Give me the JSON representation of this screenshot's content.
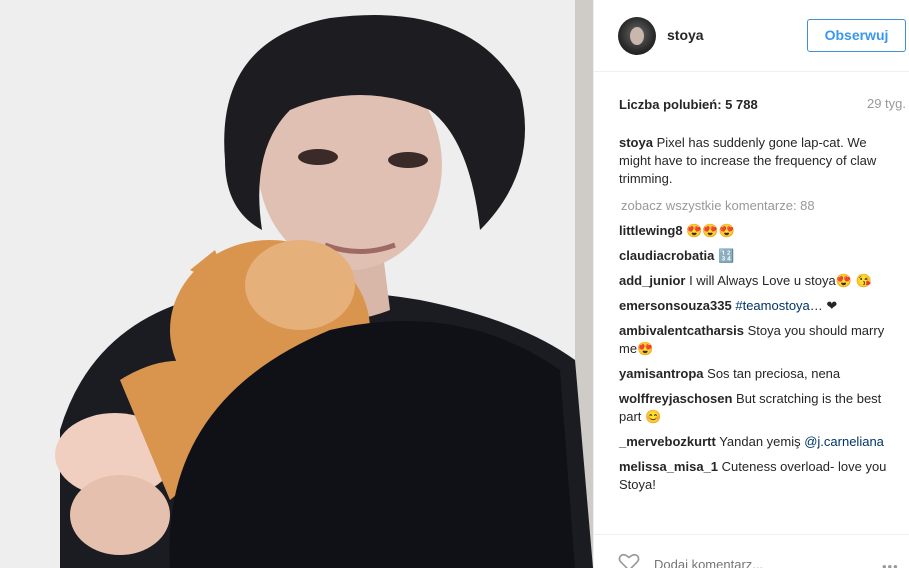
{
  "post": {
    "photo_icon": "photo",
    "username": "stoya",
    "follow_label": "Obserwuj",
    "likes_text": "Liczba polubień: 5 788",
    "time_ago": "29 tyg.",
    "caption_user": "stoya",
    "caption_text": " Pixel has suddenly gone lap-cat. We might have to increase the frequency of claw trimming.",
    "view_all": "zobacz wszystkie komentarze: 88",
    "add_comment_placeholder": "Dodaj komentarz...",
    "more_label": "•••"
  },
  "comments": [
    {
      "user": "littlewing8",
      "text": " 😍😍😍"
    },
    {
      "user": "claudiacrobatia",
      "text": " 🔢"
    },
    {
      "user": "add_junior",
      "text": " I will Always Love u stoya😍 😘"
    },
    {
      "user": "emersonsouza335",
      "text": " ",
      "tag": "#teamostoya",
      "after": "… ❤"
    },
    {
      "user": "ambivalentcatharsis",
      "text": " Stoya you should marry me😍"
    },
    {
      "user": "yamisantropa",
      "text": " Sos tan preciosa, nena"
    },
    {
      "user": "wolffreyjaschosen",
      "text": " But scratching is the best part 😊"
    },
    {
      "user": "_mervebozkurtt",
      "text": " Yandan yemiş ",
      "tag": "@j.carneliana",
      "after": ""
    },
    {
      "user": "melissa_misa_1",
      "text": " Cuteness overload- love you Stoya!"
    }
  ]
}
